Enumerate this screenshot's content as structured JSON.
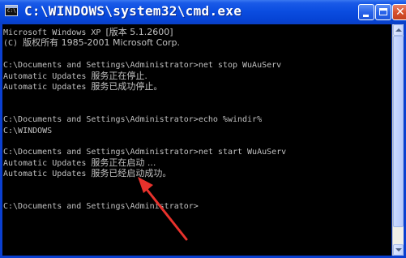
{
  "window": {
    "title": "C:\\WINDOWS\\system32\\cmd.exe",
    "icon_label": "C:\\"
  },
  "console": {
    "lines": [
      {
        "ascii": "Microsoft Windows XP ",
        "cjk": "[版本 5.1.2600]"
      },
      {
        "ascii": "(C) ",
        "cjk": "版权所有 1985-2001 Microsoft Corp."
      },
      {
        "ascii": "",
        "cjk": ""
      },
      {
        "ascii": "C:\\Documents and Settings\\Administrator>net stop WuAuServ",
        "cjk": ""
      },
      {
        "ascii": "Automatic Updates ",
        "cjk": "服务正在停止."
      },
      {
        "ascii": "Automatic Updates ",
        "cjk": "服务已成功停止。"
      },
      {
        "ascii": "",
        "cjk": ""
      },
      {
        "ascii": "",
        "cjk": ""
      },
      {
        "ascii": "C:\\Documents and Settings\\Administrator>echo %windir%",
        "cjk": ""
      },
      {
        "ascii": "C:\\WINDOWS",
        "cjk": ""
      },
      {
        "ascii": "",
        "cjk": ""
      },
      {
        "ascii": "C:\\Documents and Settings\\Administrator>net start WuAuServ",
        "cjk": ""
      },
      {
        "ascii": "Automatic Updates ",
        "cjk": "服务正在启动 ..."
      },
      {
        "ascii": "Automatic Updates ",
        "cjk": "服务已经启动成功。"
      },
      {
        "ascii": "",
        "cjk": ""
      },
      {
        "ascii": "",
        "cjk": ""
      },
      {
        "ascii": "C:\\Documents and Settings\\Administrator>",
        "cjk": ""
      }
    ]
  },
  "colors": {
    "titlebar": "#0b4de0",
    "console_background": "#000000",
    "console_text": "#c0c0c0",
    "annotation_arrow": "#e8322c"
  },
  "icons": {
    "minimize": "minimize-icon",
    "maximize": "maximize-icon",
    "close": "close-icon",
    "window": "cmd-icon"
  }
}
